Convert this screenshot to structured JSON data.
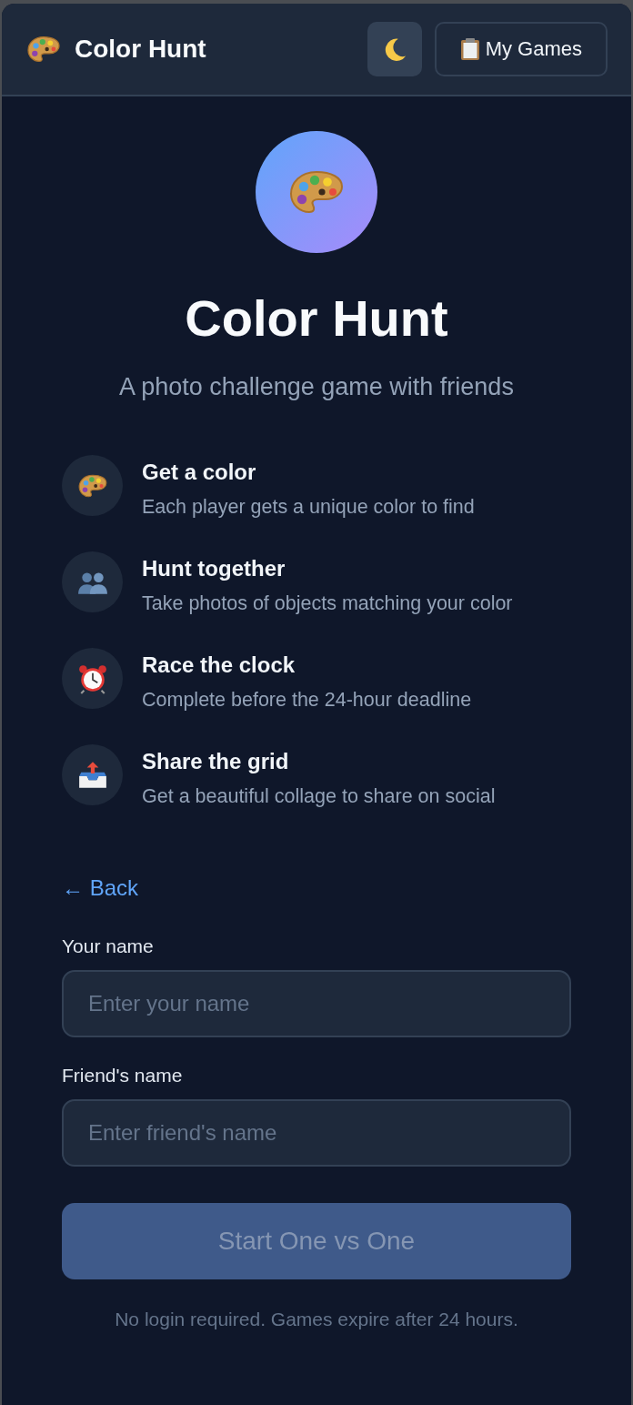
{
  "header": {
    "title": "Color Hunt",
    "games_button": {
      "label": "My Games"
    }
  },
  "hero": {
    "title": "Color Hunt",
    "subtitle": "A photo challenge game with friends"
  },
  "features": [
    {
      "title": "Get a color",
      "description": "Each player gets a unique color to find"
    },
    {
      "title": "Hunt together",
      "description": "Take photos of objects matching your color"
    },
    {
      "title": "Race the clock",
      "description": "Complete before the 24-hour deadline"
    },
    {
      "title": "Share the grid",
      "description": "Get a beautiful collage to share on social"
    }
  ],
  "back_link": "← Back",
  "fields": [
    {
      "label": "Your name",
      "placeholder": "Enter your name"
    },
    {
      "label": "Friend's name",
      "placeholder": "Enter friend's name"
    }
  ],
  "start_button": {
    "label": "Start One vs One",
    "disabled": true
  },
  "footnote": "No login required. Games expire after 24 hours."
}
